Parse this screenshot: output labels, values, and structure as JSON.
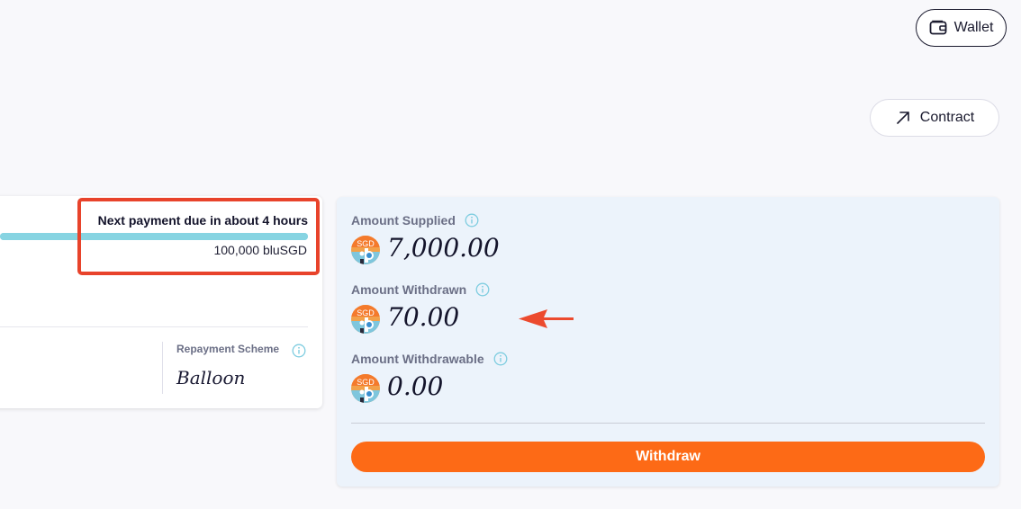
{
  "header": {
    "wallet_label": "Wallet",
    "contract_label": "Contract"
  },
  "loan_card": {
    "next_payment_text": "Next payment due in about 4 hours",
    "total_amount": "100,000 bluSGD",
    "repayment_scheme_label": "Repayment Scheme",
    "repayment_scheme_value": "Balloon"
  },
  "supply_panel": {
    "stats": [
      {
        "label": "Amount Supplied",
        "value": "7,000.00",
        "coin_text": "SGD"
      },
      {
        "label": "Amount Withdrawn",
        "value": "70.00",
        "coin_text": "SGD"
      },
      {
        "label": "Amount Withdrawable",
        "value": "0.00",
        "coin_text": "SGD"
      }
    ],
    "withdraw_label": "Withdraw"
  },
  "colors": {
    "accent": "#fd6a16",
    "annotation": "#e8432b",
    "progress": "#87d4e2",
    "info_icon": "#7fcde0"
  }
}
